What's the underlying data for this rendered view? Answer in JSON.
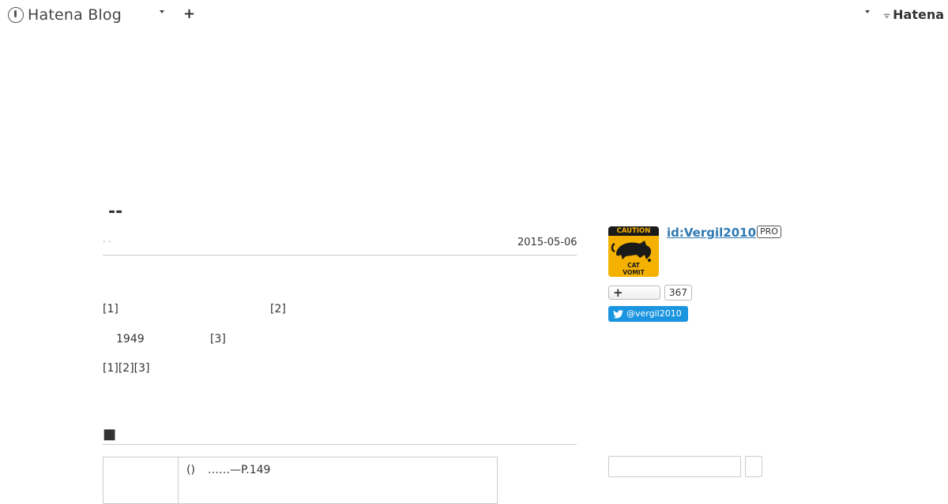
{
  "topbar": {
    "brand_text": "Hatena Blog",
    "add_label": "+",
    "hatena_text": "Hatena"
  },
  "article": {
    "title": "--",
    "categories": "· ·",
    "date": "2015-05-06",
    "paragraphs": [
      {
        "parts": [
          "[1]",
          "[2]"
        ]
      },
      {
        "parts": [
          "1949",
          "[3]"
        ]
      },
      {
        "parts": [
          "[1][2][3]"
        ]
      }
    ],
    "section_heading": "■",
    "reference_row": {
      "marker": "()",
      "text": "……—P.149"
    }
  },
  "sidebar": {
    "avatar": {
      "top_text": "CAUTION",
      "caption_line1": "CAT",
      "caption_line2": "VOMIT"
    },
    "user_id": "id:Vergil2010",
    "pro_badge": "PRO",
    "subscribe_label": "+",
    "subscriber_count": "367",
    "twitter_handle": "@vergil2010",
    "search_placeholder": ""
  },
  "colors": {
    "link": "#2f79b3",
    "twitter": "#1b95e0",
    "avatar_bg": "#f5b100",
    "rule": "#cccccc"
  }
}
